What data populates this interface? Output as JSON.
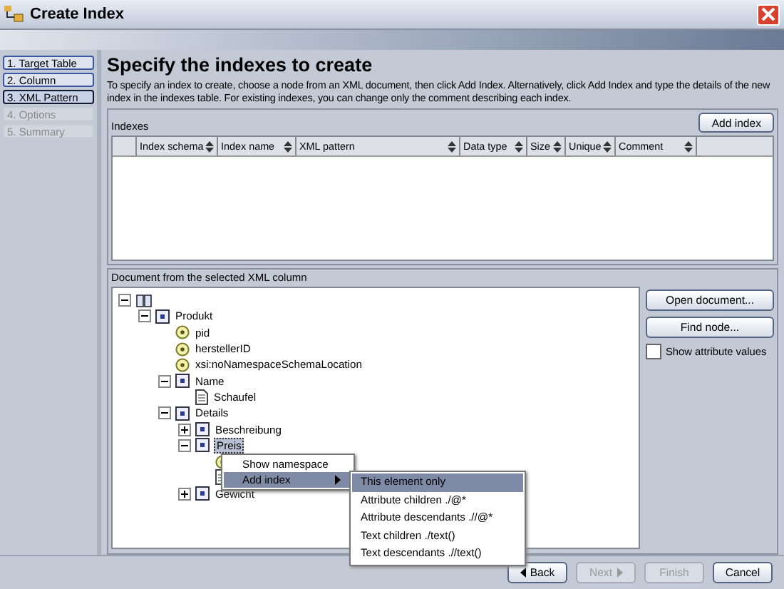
{
  "window": {
    "title": "Create Index"
  },
  "steps": [
    {
      "label": "1. Target Table",
      "enabled": true,
      "selected": false
    },
    {
      "label": "2. Column",
      "enabled": true,
      "selected": false
    },
    {
      "label": "3. XML Pattern",
      "enabled": true,
      "selected": true
    },
    {
      "label": "4. Options",
      "enabled": false,
      "selected": false
    },
    {
      "label": "5. Summary",
      "enabled": false,
      "selected": false
    }
  ],
  "header": {
    "title": "Specify the indexes to create",
    "description": "To specify an index to create, choose a node from an XML document, then click Add Index. Alternatively, click Add Index and type the details of the new index in the indexes table. For existing indexes, you can change only the comment describing each index."
  },
  "indexes": {
    "label": "Indexes",
    "add_button": "Add index",
    "columns": [
      "Index schema",
      "Index name",
      "XML pattern",
      "Data type",
      "Size",
      "Unique",
      "Comment"
    ]
  },
  "document": {
    "label": "Document from the selected XML column",
    "tree": [
      {
        "kind": "root",
        "expanded": true,
        "children": [
          {
            "kind": "element",
            "label": "Produkt",
            "expanded": true,
            "selected": false,
            "children": [
              {
                "kind": "attribute",
                "label": "pid"
              },
              {
                "kind": "attribute",
                "label": "herstellerID"
              },
              {
                "kind": "attribute",
                "label": "xsi:noNamespaceSchemaLocation"
              },
              {
                "kind": "element",
                "label": "Name",
                "expanded": true,
                "selected": false,
                "children": [
                  {
                    "kind": "text",
                    "label": "Schaufel"
                  }
                ]
              },
              {
                "kind": "element",
                "label": "Details",
                "expanded": true,
                "selected": false,
                "children": [
                  {
                    "kind": "element",
                    "label": "Beschreibung",
                    "expanded": false,
                    "selected": false
                  },
                  {
                    "kind": "element",
                    "label": "Preis",
                    "expanded": true,
                    "selected": true,
                    "children": [
                      {
                        "kind": "attribute"
                      },
                      {
                        "kind": "text"
                      }
                    ]
                  },
                  {
                    "kind": "element",
                    "label": "Gewicht",
                    "expanded": false,
                    "selected": false
                  }
                ]
              }
            ]
          }
        ]
      }
    ],
    "buttons": [
      "Open document...",
      "Find node..."
    ],
    "show_attribute_values": {
      "label": "Show attribute values",
      "checked": false
    }
  },
  "context_menu": {
    "items": [
      {
        "label": "Show namespace",
        "highlighted": false,
        "submenu": false
      },
      {
        "label": "Add index",
        "highlighted": true,
        "submenu": true
      }
    ],
    "submenu": [
      {
        "label": "This element only",
        "highlighted": true
      },
      {
        "label": "Attribute children ./@*",
        "highlighted": false
      },
      {
        "label": "Attribute descendants .//@*",
        "highlighted": false
      },
      {
        "label": "Text children ./text()",
        "highlighted": false
      },
      {
        "label": "Text descendants .//text()",
        "highlighted": false
      }
    ]
  },
  "footer": [
    {
      "label": "Back",
      "kind": "back",
      "enabled": true
    },
    {
      "label": "Next",
      "kind": "next",
      "enabled": false
    },
    {
      "label": "Finish",
      "kind": "plain",
      "enabled": false
    },
    {
      "label": "Cancel",
      "kind": "plain",
      "enabled": true
    }
  ]
}
